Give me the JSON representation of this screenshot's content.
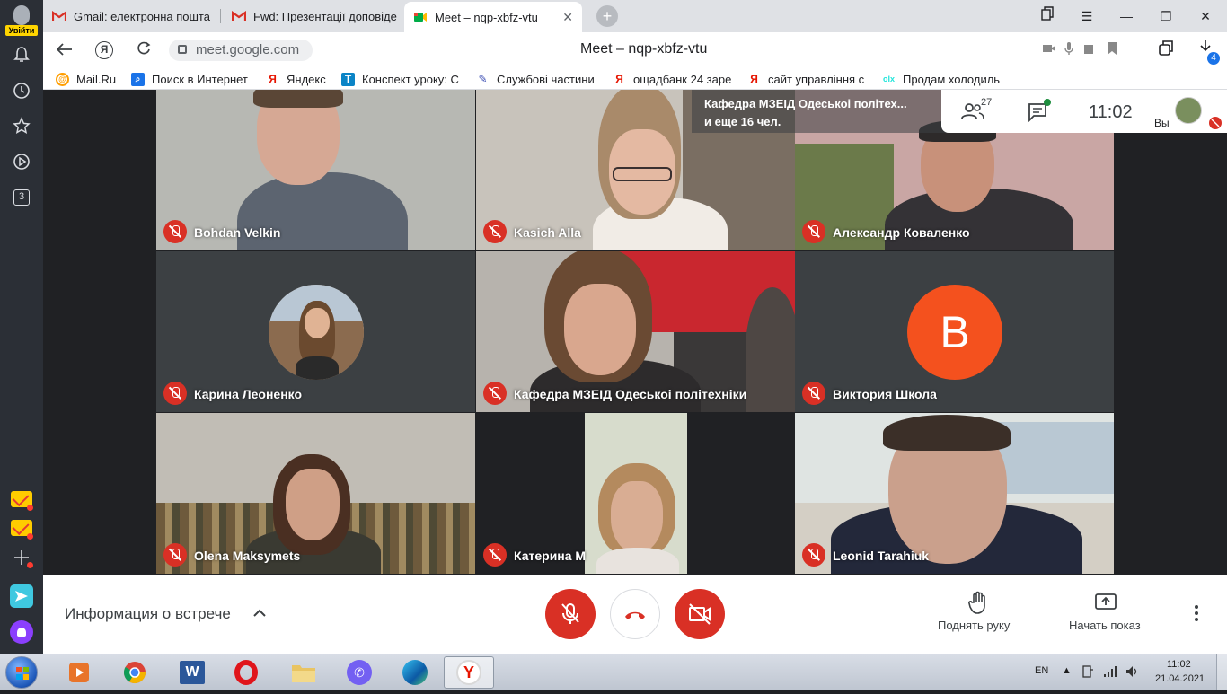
{
  "sidebar": {
    "user_button_label": "Увійти",
    "badge_count": "3"
  },
  "tabs": [
    {
      "title": "Gmail: електронна пошта",
      "icon": "gmail-icon"
    },
    {
      "title": "Fwd: Презентації доповіде",
      "icon": "gmail-icon"
    },
    {
      "title": "Meet – nqp-xbfz-vtu",
      "icon": "meet-icon",
      "active": true
    }
  ],
  "address_bar": {
    "url": "meet.google.com",
    "page_title": "Meet – nqp-xbfz-vtu",
    "downloads_badge": "4"
  },
  "bookmarks": [
    {
      "label": "Mail.Ru",
      "icon": "mailru-icon"
    },
    {
      "label": "Поиск в Интернет",
      "icon": "search-icon"
    },
    {
      "label": "Яндекс",
      "icon": "yandex-icon"
    },
    {
      "label": "Конспект уроку: С",
      "icon": "t-icon"
    },
    {
      "label": "Службові частини",
      "icon": "pen-icon"
    },
    {
      "label": "ощадбанк 24 заре",
      "icon": "yandex-icon"
    },
    {
      "label": "сайт управління с",
      "icon": "yandex-icon"
    },
    {
      "label": "Продам холодиль",
      "icon": "olx-icon"
    }
  ],
  "meet": {
    "speaker_note_line1": "Кафедра МЗЕІД Одеськоі політех...",
    "speaker_note_line2": "и еще 16 чел.",
    "participants_count": "27",
    "clock": "11:02",
    "you_label": "Вы",
    "participants": [
      {
        "name": "Bohdan Velkin"
      },
      {
        "name": "Kasich Alla"
      },
      {
        "name": "Александр Коваленко"
      },
      {
        "name": "Карина Леоненко"
      },
      {
        "name": "Кафедра МЗЕІД Одеськоі політехніки"
      },
      {
        "name": "Виктория Школа",
        "initial": "В"
      },
      {
        "name": "Olena Maksymets"
      },
      {
        "name": "Катерина М"
      },
      {
        "name": "Leonid Tarahiuk"
      }
    ]
  },
  "controls": {
    "meeting_info": "Информация о встрече",
    "raise_hand": "Поднять руку",
    "present": "Начать показ"
  },
  "taskbar": {
    "language": "EN",
    "time": "11:02",
    "date": "21.04.2021"
  },
  "colors": {
    "meet_background": "#202124",
    "danger_red": "#d93025",
    "avatar_orange": "#f4511e"
  }
}
